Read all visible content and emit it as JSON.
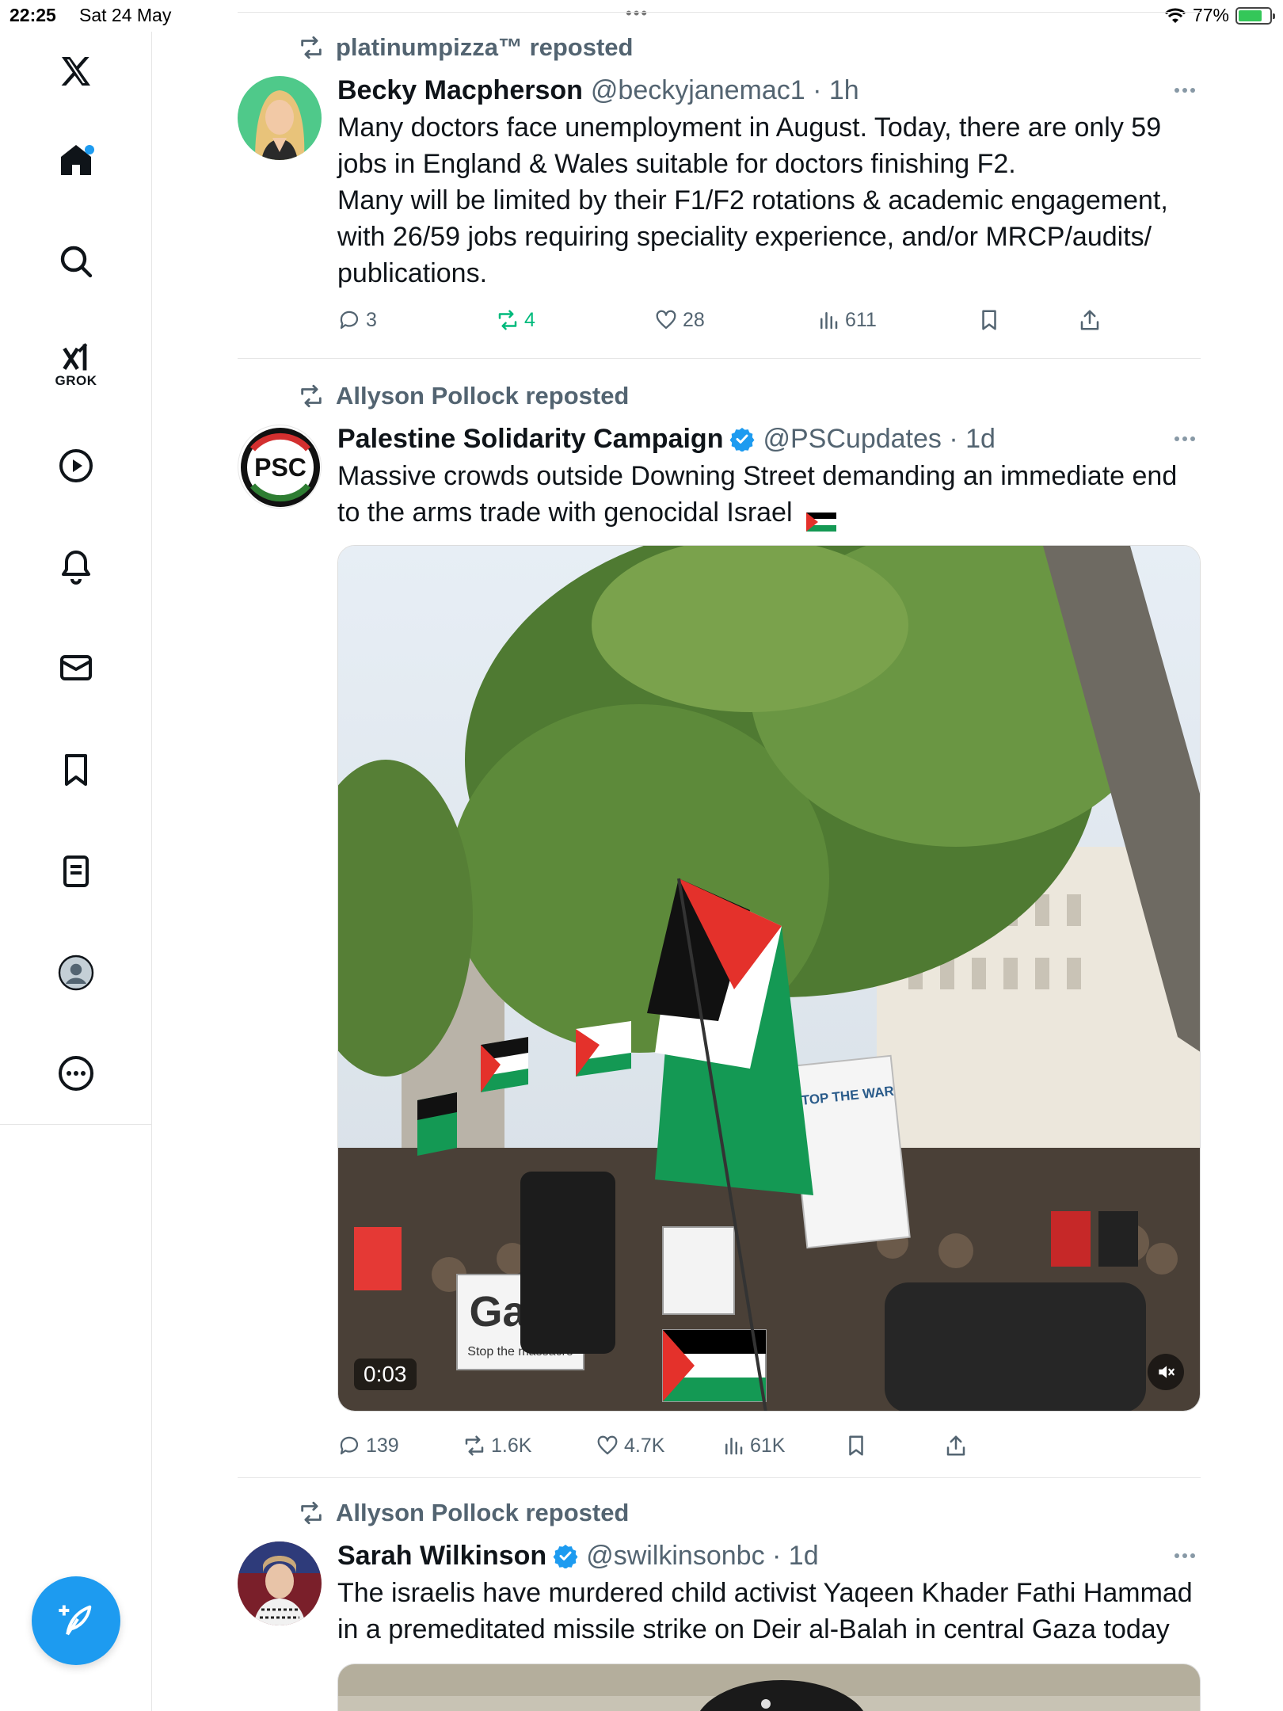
{
  "status_bar": {
    "time": "22:25",
    "date": "Sat 24 May",
    "battery": "77%"
  },
  "sidebar": {
    "items": [
      {
        "name": "x-logo-icon"
      },
      {
        "name": "home-icon"
      },
      {
        "name": "search-icon"
      },
      {
        "name": "grok-icon",
        "label": "GROK"
      },
      {
        "name": "video-icon"
      },
      {
        "name": "notifications-icon"
      },
      {
        "name": "messages-icon"
      },
      {
        "name": "bookmarks-icon"
      },
      {
        "name": "lists-icon"
      },
      {
        "name": "profile-icon"
      },
      {
        "name": "more-icon"
      }
    ]
  },
  "posts": [
    {
      "reposted_by": "platinumpizza™ reposted",
      "name": "Becky Macpherson",
      "handle": "@beckyjanemac1 · 1h",
      "lines": [
        "Many doctors face unemployment in August. Today, there are only 59 jobs in England & Wales suitable for doctors finishing F2.",
        "Many will be limited by their F1/F2 rotations & academic engagement, with 26/59 jobs requiring speciality experience, and/or MRCP/audits/ publications."
      ],
      "replies": "3",
      "reposts": "4",
      "likes": "28",
      "views": "611"
    },
    {
      "reposted_by": "Allyson Pollock reposted",
      "name": "Palestine Solidarity Campaign",
      "handle": "@PSCupdates · 1d",
      "text": "Massive crowds outside Downing Street demanding an immediate end to the arms trade with genocidal Israel",
      "avatar_text": "PSC",
      "video_duration": "0:03",
      "sign_text_1": "Gaza",
      "sign_text_2": "Stop the massacre",
      "sign_text_3": "STOP THE WAR",
      "replies": "139",
      "reposts": "1.6K",
      "likes": "4.7K",
      "views": "61K"
    },
    {
      "reposted_by": "Allyson Pollock reposted",
      "name": "Sarah Wilkinson",
      "handle": "@swilkinsonbc · 1d",
      "text": "The israelis have murdered child activist Yaqeen Khader Fathi Hammad in a premeditated missile strike on Deir al-Balah in central Gaza today"
    }
  ],
  "colors": {
    "accent": "#1d9bf0",
    "repost_green": "#00ba7c",
    "muted": "#536471"
  }
}
